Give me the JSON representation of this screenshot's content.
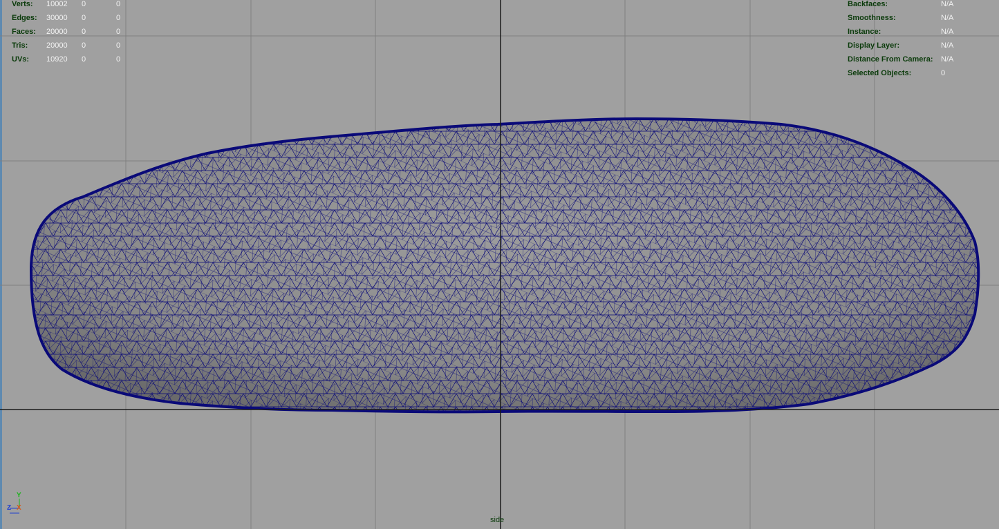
{
  "left_stats": [
    {
      "label": "Verts:",
      "values": [
        "10002",
        "0",
        "0"
      ]
    },
    {
      "label": "Edges:",
      "values": [
        "30000",
        "0",
        "0"
      ]
    },
    {
      "label": "Faces:",
      "values": [
        "20000",
        "0",
        "0"
      ]
    },
    {
      "label": "Tris:",
      "values": [
        "20000",
        "0",
        "0"
      ]
    },
    {
      "label": "UVs:",
      "values": [
        "10920",
        "0",
        "0"
      ]
    }
  ],
  "right_stats": [
    {
      "label": "Backfaces:",
      "value": "N/A"
    },
    {
      "label": "Smoothness:",
      "value": "N/A"
    },
    {
      "label": "Instance:",
      "value": "N/A"
    },
    {
      "label": "Display Layer:",
      "value": "N/A"
    },
    {
      "label": "Distance From Camera:",
      "value": "N/A"
    },
    {
      "label": "Selected Objects:",
      "value": "0"
    }
  ],
  "view_label": "side",
  "axis": {
    "y": "Y",
    "z": "Z",
    "x": "X"
  },
  "colors": {
    "background": "#a0a0a0",
    "grid": "#7f7f7f",
    "origin_axis": "#1a1a1a",
    "mesh_fill": "#8b8b8b",
    "wireframe": "#0a0a78",
    "hud_label": "#0b3b0b",
    "hud_value": "#f2f2f2"
  }
}
